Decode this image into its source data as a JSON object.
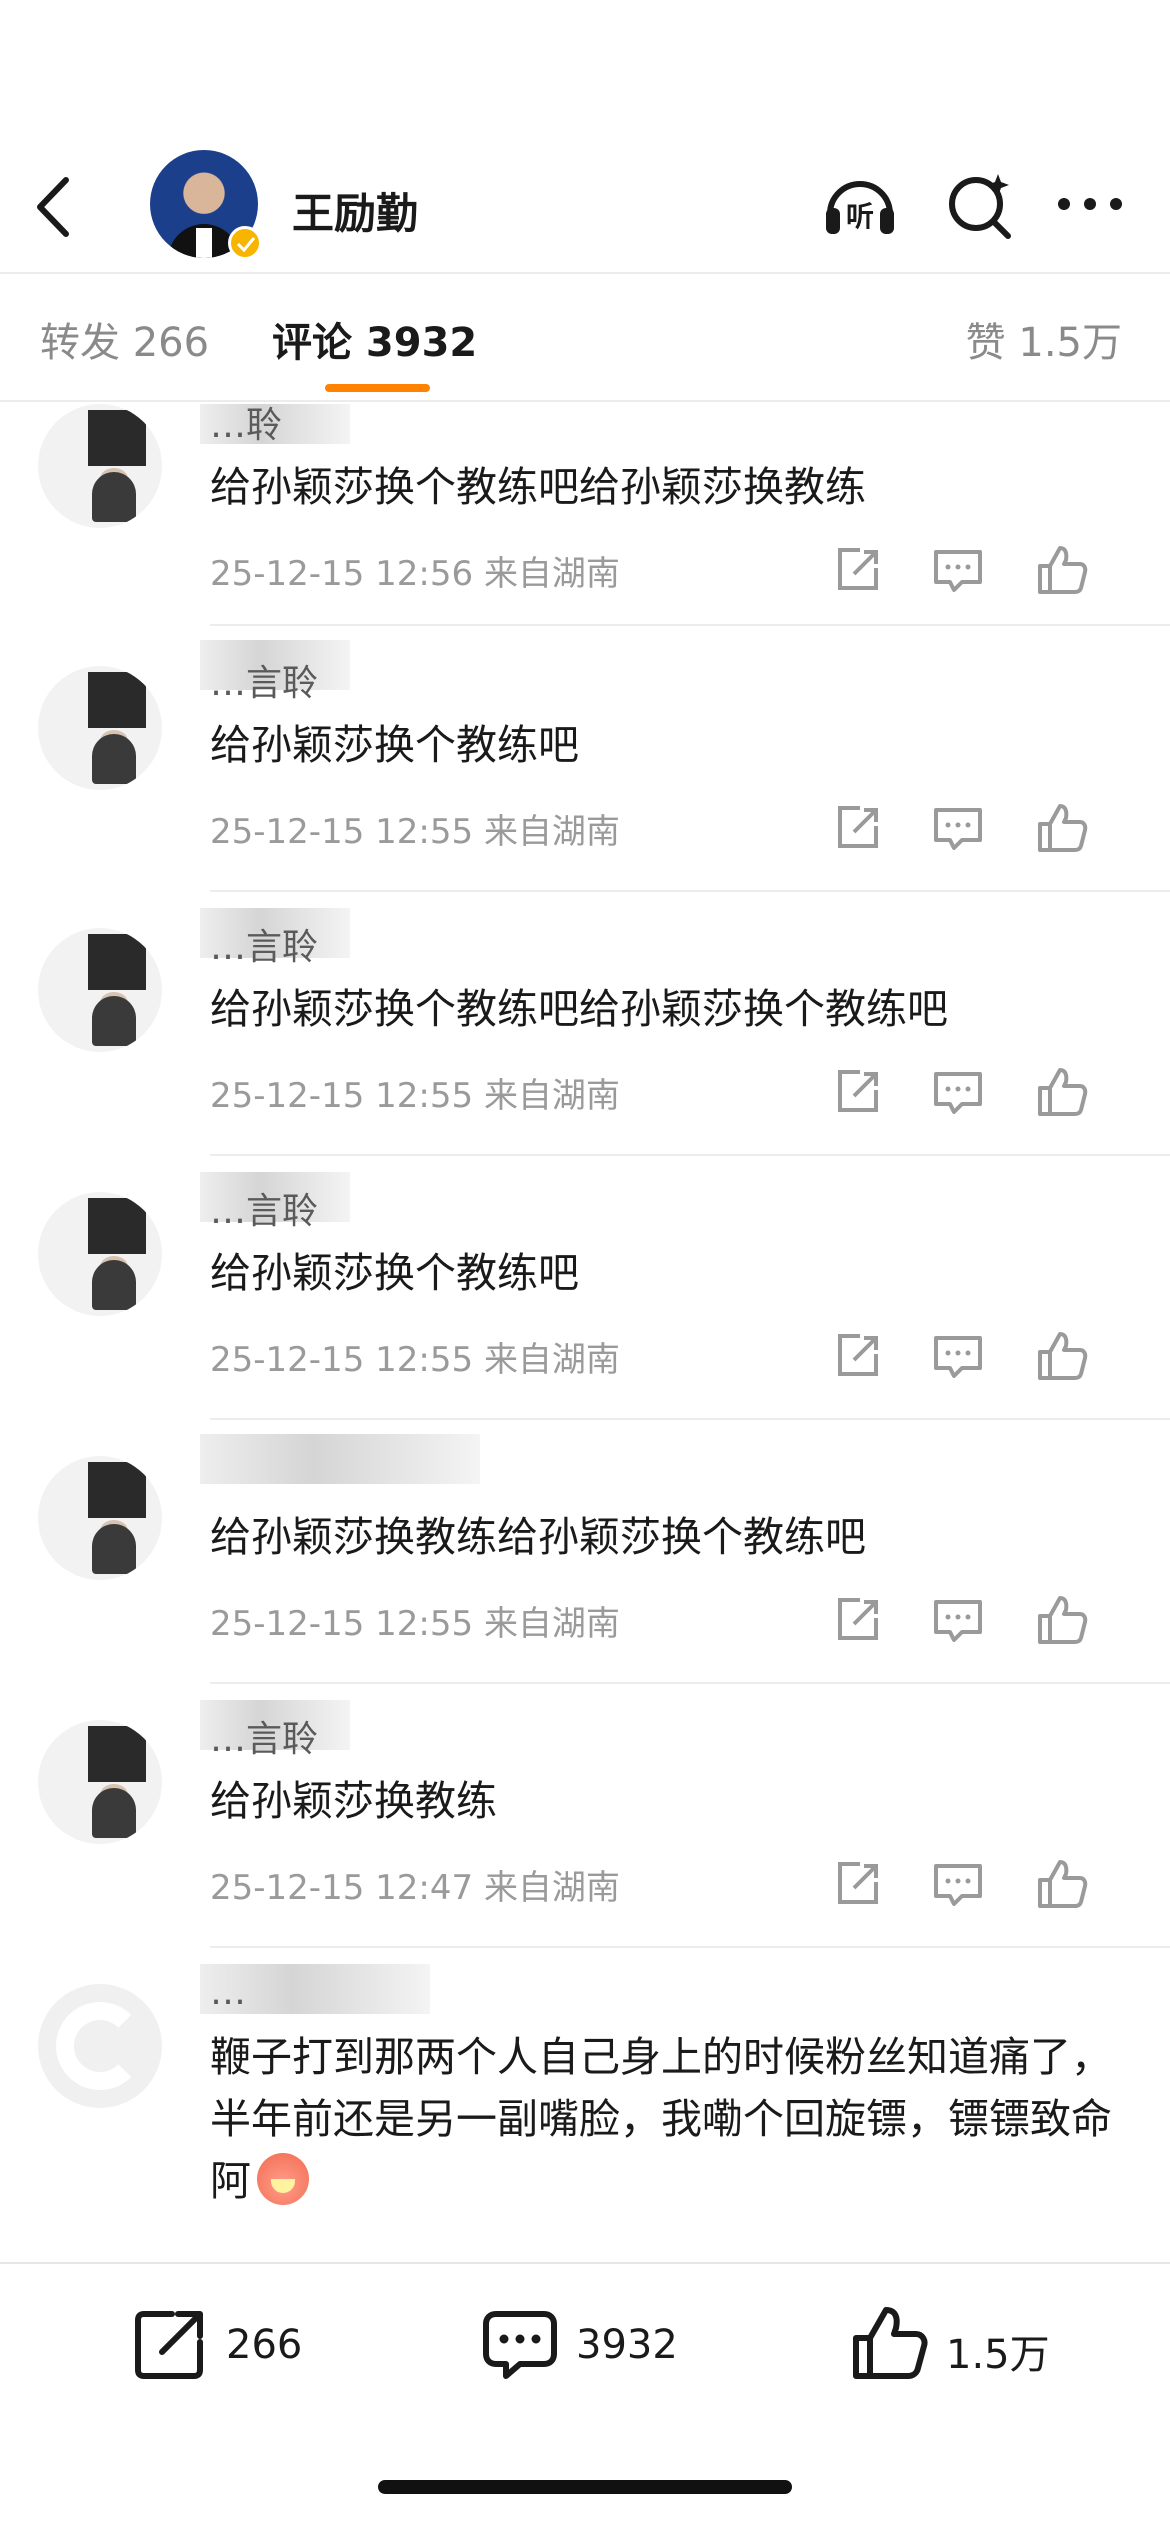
{
  "header": {
    "title": "王励勤",
    "icons": {
      "back": "back-chevron-icon",
      "listen": "listen-icon",
      "search": "ai-search-icon",
      "more": "more-icon"
    }
  },
  "tabs": {
    "reposts": "转发 266",
    "comments": "评论 3932",
    "likes": "赞 1.5万"
  },
  "comments": [
    {
      "name": "…聆",
      "text": "给孙颖莎换个教练吧给孙颖莎换教练",
      "time": "25-12-15 12:56",
      "location": "来自湖南"
    },
    {
      "name": "…言聆",
      "text": "给孙颖莎换个教练吧",
      "time": "25-12-15 12:55",
      "location": "来自湖南"
    },
    {
      "name": "…言聆",
      "text": "给孙颖莎换个教练吧给孙颖莎换个教练吧",
      "time": "25-12-15 12:55",
      "location": "来自湖南"
    },
    {
      "name": "…言聆",
      "text": "给孙颖莎换个教练吧",
      "time": "25-12-15 12:55",
      "location": "来自湖南"
    },
    {
      "name": "",
      "text": "给孙颖莎换教练给孙颖莎换个教练吧",
      "time": "25-12-15 12:55",
      "location": "来自湖南"
    },
    {
      "name": "…言聆",
      "text": "给孙颖莎换教练",
      "time": "25-12-15 12:47",
      "location": "来自湖南"
    },
    {
      "name": "…",
      "text": "鞭子打到那两个人自己身上的时候粉丝知道痛了，半年前还是另一副嘴脸，我嘞个回旋镖，镖镖致命阿"
    }
  ],
  "bottom_bar": {
    "reposts": "266",
    "comments": "3932",
    "likes": "1.5万"
  },
  "colors": {
    "accent": "#ff8200",
    "verified": "#f7b500",
    "meta": "#9a9a9a"
  }
}
